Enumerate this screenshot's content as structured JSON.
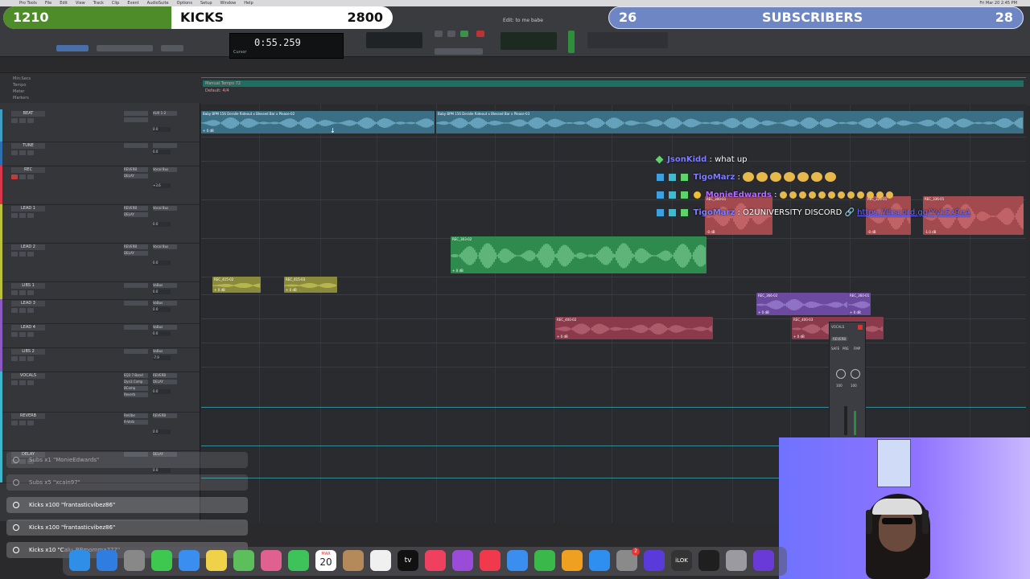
{
  "menubar": {
    "items": [
      "Pro Tools",
      "File",
      "Edit",
      "View",
      "Track",
      "Clip",
      "Event",
      "AudioSuite",
      "Options",
      "Setup",
      "Window",
      "Help"
    ],
    "clock": "Fri Mar 20  2:45 PM"
  },
  "transport": {
    "counter": "0:55.259",
    "cursor_label": "Cursor",
    "edit_info": "Edit: to me babe"
  },
  "rulers": {
    "labels": [
      "Min:Secs",
      "Tempo",
      "Meter",
      "Markers"
    ],
    "tempo_text": "Manual Tempo  72",
    "meter_text": "Default: 4/4"
  },
  "colors": {
    "beat": "#3f9fc2",
    "rec": "#d8364a",
    "lead": "#b9c23a",
    "vocals": "#3fb6c9",
    "green_clip": "#2f8a4e",
    "red_clip": "#b2444a",
    "purple_clip": "#6b4aa0",
    "kicks_fill": "#4e8c2a",
    "subs_fill": "#6f86c4"
  },
  "tracks": [
    {
      "name": "BEAT",
      "color": "#3f9fc2",
      "inserts": [
        "",
        ""
      ],
      "sends": [
        "AUX 1-2"
      ],
      "vol": "0.0"
    },
    {
      "name": "TUNE",
      "color": "#2f6fb0",
      "inserts": [
        ""
      ],
      "sends": [
        ""
      ],
      "vol": "0.0"
    },
    {
      "name": "REC",
      "color": "#d8364a",
      "inserts": [
        "REVERB",
        "DELAY"
      ],
      "sends": [
        "Vocal Bus"
      ],
      "vol": "+3.6"
    },
    {
      "name": "LEAD 1",
      "color": "#b9c23a",
      "inserts": [
        "REVERB",
        "DELAY"
      ],
      "sends": [
        "Vocal Bus"
      ],
      "vol": "0.0"
    },
    {
      "name": "LEAD 2",
      "color": "#b9c23a",
      "inserts": [
        "REVERB",
        "DELAY"
      ],
      "sends": [
        "Vocal Bus"
      ],
      "vol": "0.0"
    },
    {
      "name": "LIBS 1",
      "color": "#b9c23a",
      "inserts": [
        ""
      ],
      "sends": [
        "VoBus"
      ],
      "vol": "0.0"
    },
    {
      "name": "LEAD 3",
      "color": "#8a5ac2",
      "inserts": [
        ""
      ],
      "sends": [
        "VoBus"
      ],
      "vol": "0.0"
    },
    {
      "name": "LEAD 4",
      "color": "#8a5ac2",
      "inserts": [
        ""
      ],
      "sends": [
        "VoBus"
      ],
      "vol": "0.0"
    },
    {
      "name": "LIBS 2",
      "color": "#8a5ac2",
      "inserts": [
        ""
      ],
      "sends": [
        "VoBus"
      ],
      "vol": "-7.9"
    },
    {
      "name": "VOCALS",
      "color": "#3fb6c9",
      "inserts": [
        "EQ3 7-Band",
        "Dyn3 Comp",
        "BComp",
        "Reverb"
      ],
      "sends": [
        "REVERB",
        "DELAY"
      ],
      "vol": "0.0"
    },
    {
      "name": "REVERB",
      "color": "#3fb6c9",
      "inserts": [
        "ReVibe",
        "R-Verb"
      ],
      "sends": [
        "REVERB"
      ],
      "vol": "0.0"
    },
    {
      "name": "DELAY",
      "color": "#3fb6c9",
      "inserts": [
        ""
      ],
      "sends": [
        "DELAY"
      ],
      "vol": "0.0"
    }
  ],
  "clips": [
    {
      "lane": 0,
      "name": "Baby BPM 156 Deralle Rideout x Blessed Bar x Please-02",
      "gain": "+ 0 dB"
    },
    {
      "lane": 0,
      "name": "Baby BPM 156 Deralle Rideout x Blessed Bar x Please-03",
      "gain": ""
    },
    {
      "lane": 2,
      "name": "REC_300-01",
      "gain": "-0 dB"
    },
    {
      "lane": 2,
      "name": "REC_326-01",
      "gain": "-0 dB"
    },
    {
      "lane": 2,
      "name": "REC_336-01",
      "gain": "-1.0 dB"
    },
    {
      "lane": 4,
      "name": "REC_303-02",
      "gain": "+ 0 dB"
    },
    {
      "lane": 5,
      "name": "REC_415-02",
      "gain": "+ 0 dB"
    },
    {
      "lane": 5,
      "name": "REC_415-03",
      "gain": "+ 0 dB"
    },
    {
      "lane": 6,
      "name": "REC_366-02",
      "gain": "+ 0 dB"
    },
    {
      "lane": 6,
      "name": "REC_360-01",
      "gain": "+ 0 dB"
    },
    {
      "lane": 7,
      "name": "REC_400-02",
      "gain": "+ 0 dB"
    },
    {
      "lane": 7,
      "name": "REC_400-03",
      "gain": "+ 0 dB"
    }
  ],
  "kicks_goal": {
    "current": "1210",
    "title": "KICKS",
    "goal": "2800",
    "progress": 0.432
  },
  "subs_goal": {
    "current": "26",
    "title": "SUBSCRIBERS",
    "goal": "28",
    "progress": 0.93
  },
  "chat": [
    {
      "user": "JsonKidd",
      "user_color": "#7e7eff",
      "text": "what up"
    },
    {
      "user": "TigoMarz",
      "user_color": "#7e7eff",
      "text": ""
    },
    {
      "user": "MonieEdwards",
      "user_color": "#b36bff",
      "text": ""
    },
    {
      "user": "TigoMarz",
      "user_color": "#7e7eff",
      "text": "O2UNIVERSITY DISCORD",
      "link": "https://discord.gg/YykEx9eA"
    }
  ],
  "alerts": [
    {
      "text": "Subs x1 \"MonieEdwards\""
    },
    {
      "text": "Subs x5 \"xcain97\""
    },
    {
      "text": "Kicks x100 \"frantasticvibez86\""
    },
    {
      "text": "Kicks x100 \"frantasticvibez86\""
    },
    {
      "text": "Kicks x10 \"Calu_BBmomma777\""
    }
  ],
  "mini_fader": {
    "name": "VOCALS",
    "insert": "REVERB",
    "btn1": "SAFE",
    "btn2": "PRE",
    "btn3": "FMP",
    "vol": "100",
    "vol2": "100"
  },
  "dock": {
    "icons": [
      "finder-icon",
      "safari-icon",
      "launchpad-icon",
      "messages-icon",
      "mail-icon",
      "notes-icon",
      "maps-icon",
      "photos-icon",
      "facetime-icon",
      "calendar-icon",
      "contacts-icon",
      "reminders-icon",
      "appletv-icon",
      "music-icon",
      "podcasts-icon",
      "news-icon",
      "keynote-icon",
      "numbers-icon",
      "pages-icon",
      "appstore-icon",
      "settings-icon",
      "protools-icon",
      "ilok-icon",
      "obs-icon",
      "disk-icon",
      "ableton-icon"
    ],
    "calendar_month": "MAR",
    "calendar_day": "20",
    "appletv_label": "tv",
    "ilok_label": "iLOK",
    "settings_badge": "2"
  }
}
